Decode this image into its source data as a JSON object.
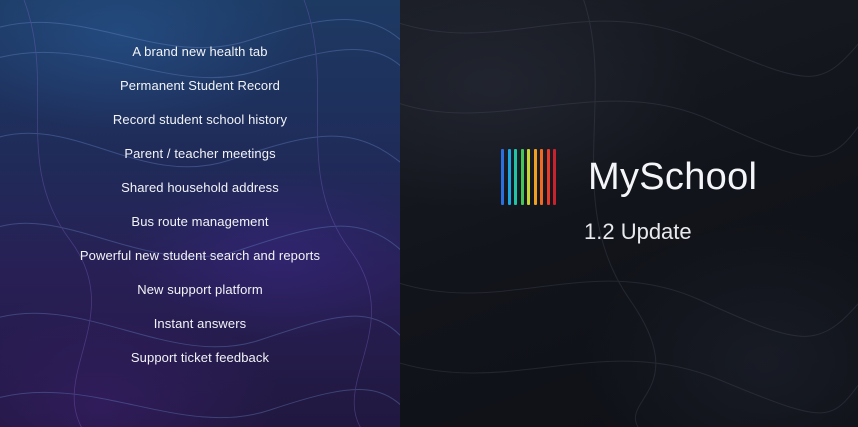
{
  "features": {
    "items": [
      "A brand new health tab",
      "Permanent Student Record",
      "Record student school history",
      "Parent / teacher meetings",
      "Shared household address",
      "Bus route management",
      "Powerful new student search and reports",
      "New support platform",
      "Instant answers",
      "Support ticket feedback"
    ]
  },
  "brand": {
    "name": "MySchool",
    "version": "1.2 Update",
    "logo_icon": "rainbow-bars-icon",
    "logo_colors": [
      "#2b6fe0",
      "#1aa7e0",
      "#22c4a8",
      "#46c45a",
      "#c6d630",
      "#f0a020",
      "#ef6a22",
      "#e63a2a",
      "#c8232c"
    ]
  },
  "colors": {
    "left_panel": "#1f2c5a",
    "right_panel": "#12141b",
    "text": "#f2f3f7"
  }
}
